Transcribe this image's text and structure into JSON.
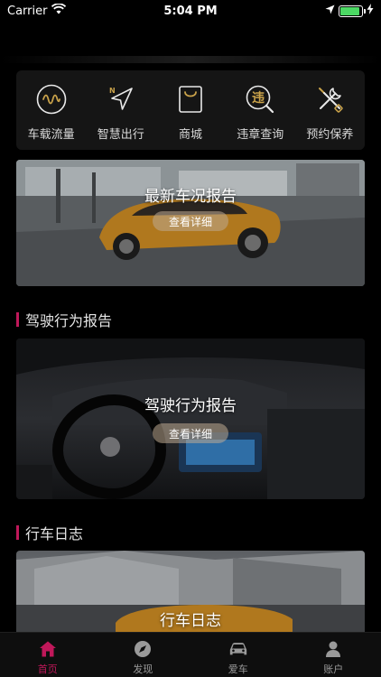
{
  "status_bar": {
    "carrier": "Carrier",
    "time": "5:04 PM",
    "battery_level": 0.9
  },
  "quick_actions": [
    {
      "label": "车载流量",
      "icon": "waveform-icon"
    },
    {
      "label": "智慧出行",
      "icon": "navigation-arrow-icon"
    },
    {
      "label": "商城",
      "icon": "shopping-bag-icon"
    },
    {
      "label": "违章查询",
      "icon": "violation-search-icon",
      "icon_char": "违"
    },
    {
      "label": "预约保养",
      "icon": "tools-icon"
    }
  ],
  "banners": {
    "report": {
      "title": "最新车况报告",
      "button": "查看详细"
    },
    "driving": {
      "title": "驾驶行为报告",
      "button": "查看详细"
    },
    "log": {
      "title": "行车日志"
    }
  },
  "sections": {
    "driving": "驾驶行为报告",
    "log": "行车日志"
  },
  "tabs": [
    {
      "label": "首页",
      "icon": "home-icon",
      "active": true
    },
    {
      "label": "发现",
      "icon": "compass-icon",
      "active": false
    },
    {
      "label": "爱车",
      "icon": "car-icon",
      "active": false
    },
    {
      "label": "账户",
      "icon": "user-icon",
      "active": false
    }
  ],
  "colors": {
    "accent": "#c0185a",
    "gold": "#c9a24a",
    "background": "#000000",
    "card": "#151515"
  }
}
